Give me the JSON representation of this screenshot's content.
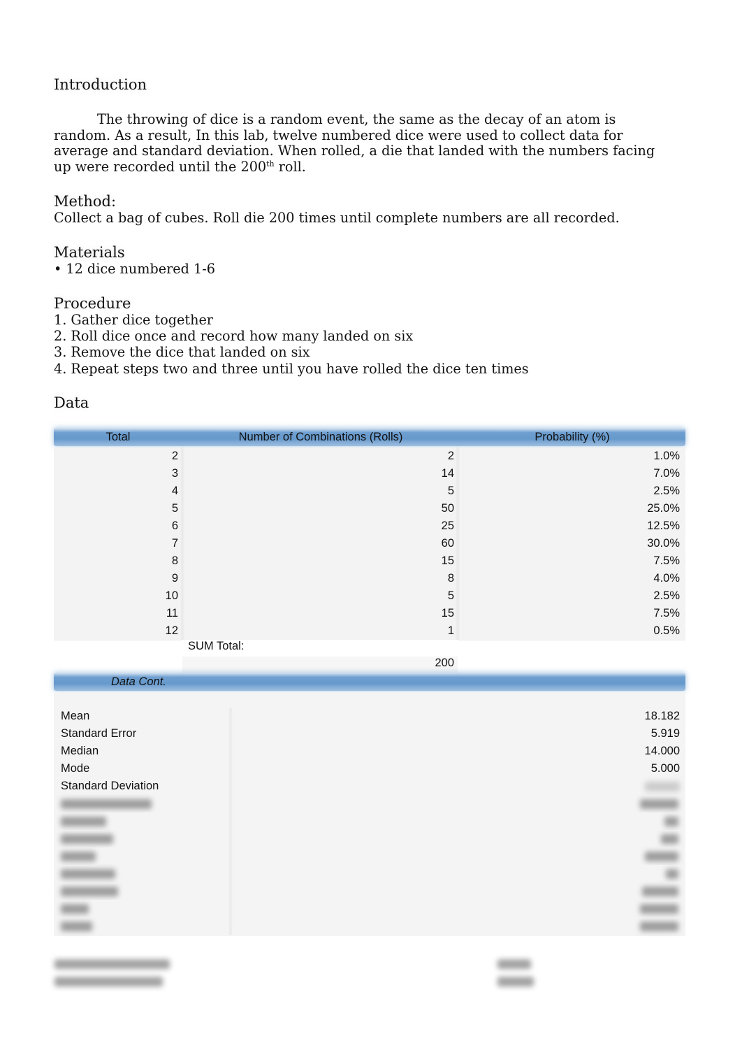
{
  "sections": {
    "introduction": {
      "heading": "Introduction",
      "line1": "The throwing of dice is a random event, the same as the decay of an atom is",
      "line2": "random.  As a result, In this lab, twelve numbered dice were used to collect data for",
      "line3": "average and standard deviation.  When rolled, a die that landed with the numbers facing",
      "line4_pre": "up were recorded until the 200",
      "line4_sup": "th",
      "line4_post": " roll."
    },
    "method": {
      "heading": "Method:",
      "text": "Collect a bag of cubes.  Roll die 200 times until complete numbers are all recorded."
    },
    "materials": {
      "heading": "Materials",
      "items": [
        "• 12 dice numbered 1-6"
      ]
    },
    "procedure": {
      "heading": "Procedure",
      "steps": [
        "1. Gather dice together",
        "2. Roll dice once and record how many landed on six",
        "3. Remove the dice that landed on six",
        "4. Repeat steps two and three until you have rolled the dice ten times"
      ]
    },
    "data": {
      "heading": "Data"
    }
  },
  "table": {
    "headers": [
      "Total",
      "Number of Combinations (Rolls)",
      "Probability (%)"
    ],
    "rows": [
      [
        "2",
        "2",
        "1.0%"
      ],
      [
        "3",
        "14",
        "7.0%"
      ],
      [
        "4",
        "5",
        "2.5%"
      ],
      [
        "5",
        "50",
        "25.0%"
      ],
      [
        "6",
        "25",
        "12.5%"
      ],
      [
        "7",
        "60",
        "30.0%"
      ],
      [
        "8",
        "15",
        "7.5%"
      ],
      [
        "9",
        "8",
        "4.0%"
      ],
      [
        "10",
        "5",
        "2.5%"
      ],
      [
        "11",
        "15",
        "7.5%"
      ],
      [
        "12",
        "1",
        "0.5%"
      ]
    ],
    "sum_label": "SUM Total:",
    "sum_value": "200"
  },
  "stats": {
    "header": "Data Cont.",
    "rows": [
      {
        "label": "Mean",
        "value": "18.182"
      },
      {
        "label": "Standard Error",
        "value": "5.919"
      },
      {
        "label": "Median",
        "value": "14.000"
      },
      {
        "label": "Mode",
        "value": "5.000"
      },
      {
        "label": "Standard Deviation",
        "value": ""
      }
    ]
  }
}
